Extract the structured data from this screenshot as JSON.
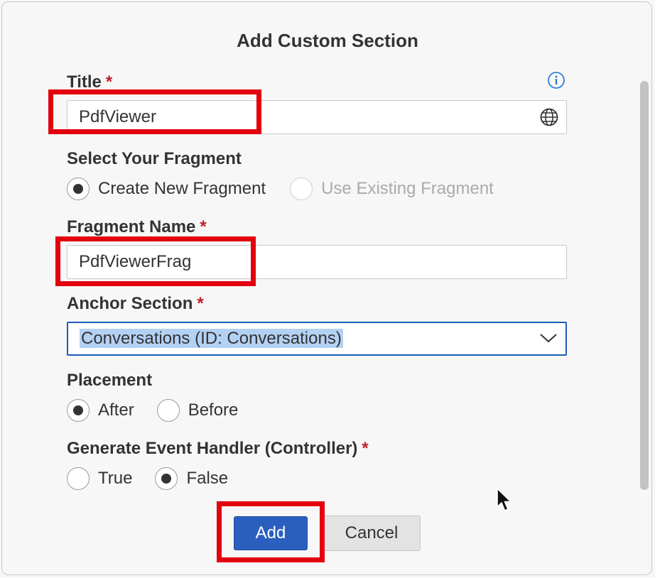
{
  "dialog": {
    "title": "Add Custom Section"
  },
  "form": {
    "title_label": "Title",
    "title_value": "PdfViewer",
    "fragment_label": "Select Your Fragment",
    "fragment_options": [
      "Create New Fragment",
      "Use Existing Fragment"
    ],
    "fragment_selected": "Create New Fragment",
    "fragment_name_label": "Fragment Name",
    "fragment_name_value": "PdfViewerFrag",
    "anchor_label": "Anchor Section",
    "anchor_value": "Conversations (ID: Conversations)",
    "placement_label": "Placement",
    "placement_options": [
      "After",
      "Before"
    ],
    "placement_selected": "After",
    "handler_label": "Generate Event Handler (Controller)",
    "handler_options": [
      "True",
      "False"
    ],
    "handler_selected": "False",
    "required_mark": "*"
  },
  "buttons": {
    "add": "Add",
    "cancel": "Cancel"
  },
  "icons": {
    "info": "info-icon",
    "globe": "globe-icon",
    "dropdown": "chevron-down-icon",
    "cursor": "mouse-cursor-icon"
  },
  "colors": {
    "primary_button": "#2a5fbf",
    "required": "#c0202a",
    "highlight_box": "#e3000f",
    "selection": "#b3d1f3",
    "info_icon": "#2a7fd4"
  }
}
